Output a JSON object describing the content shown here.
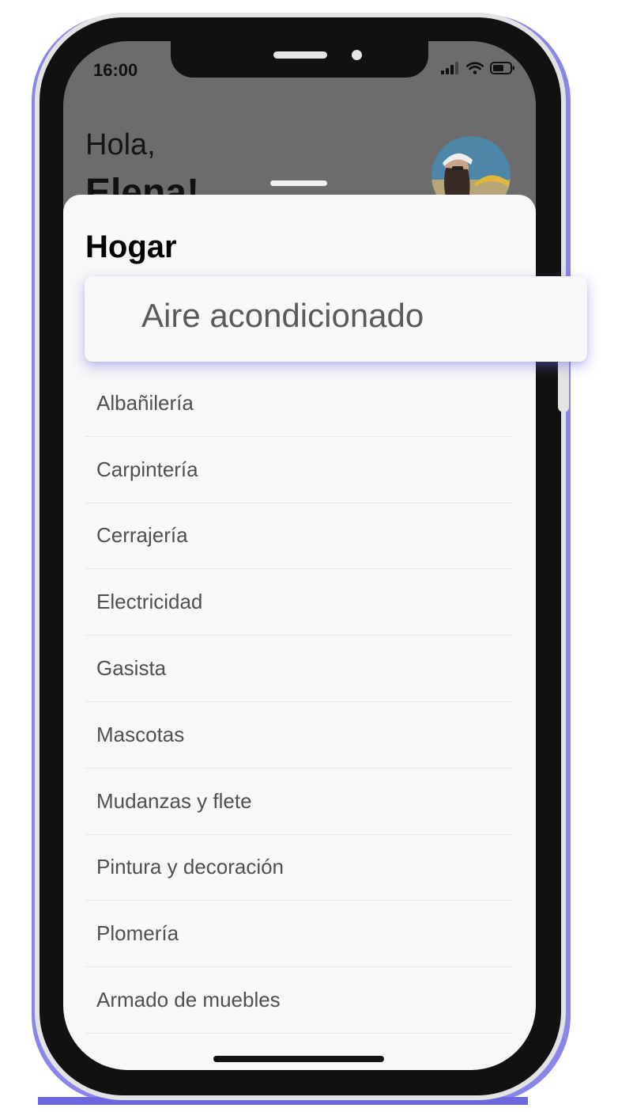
{
  "status_bar": {
    "time": "16:00"
  },
  "header": {
    "greeting": "Hola,",
    "user_name": "Elena!"
  },
  "sheet": {
    "title": "Hogar",
    "selected_item": "Aire acondicionado",
    "items": [
      "Albañilería",
      "Carpintería",
      "Cerrajería",
      "Electricidad",
      "Gasista",
      "Mascotas",
      "Mudanzas y flete",
      "Pintura y decoración",
      "Plomería",
      "Armado de muebles"
    ]
  },
  "colors": {
    "accent_glow": "#8a85e8",
    "sheet_bg": "#f8f8f8",
    "divider": "#ece7df"
  }
}
